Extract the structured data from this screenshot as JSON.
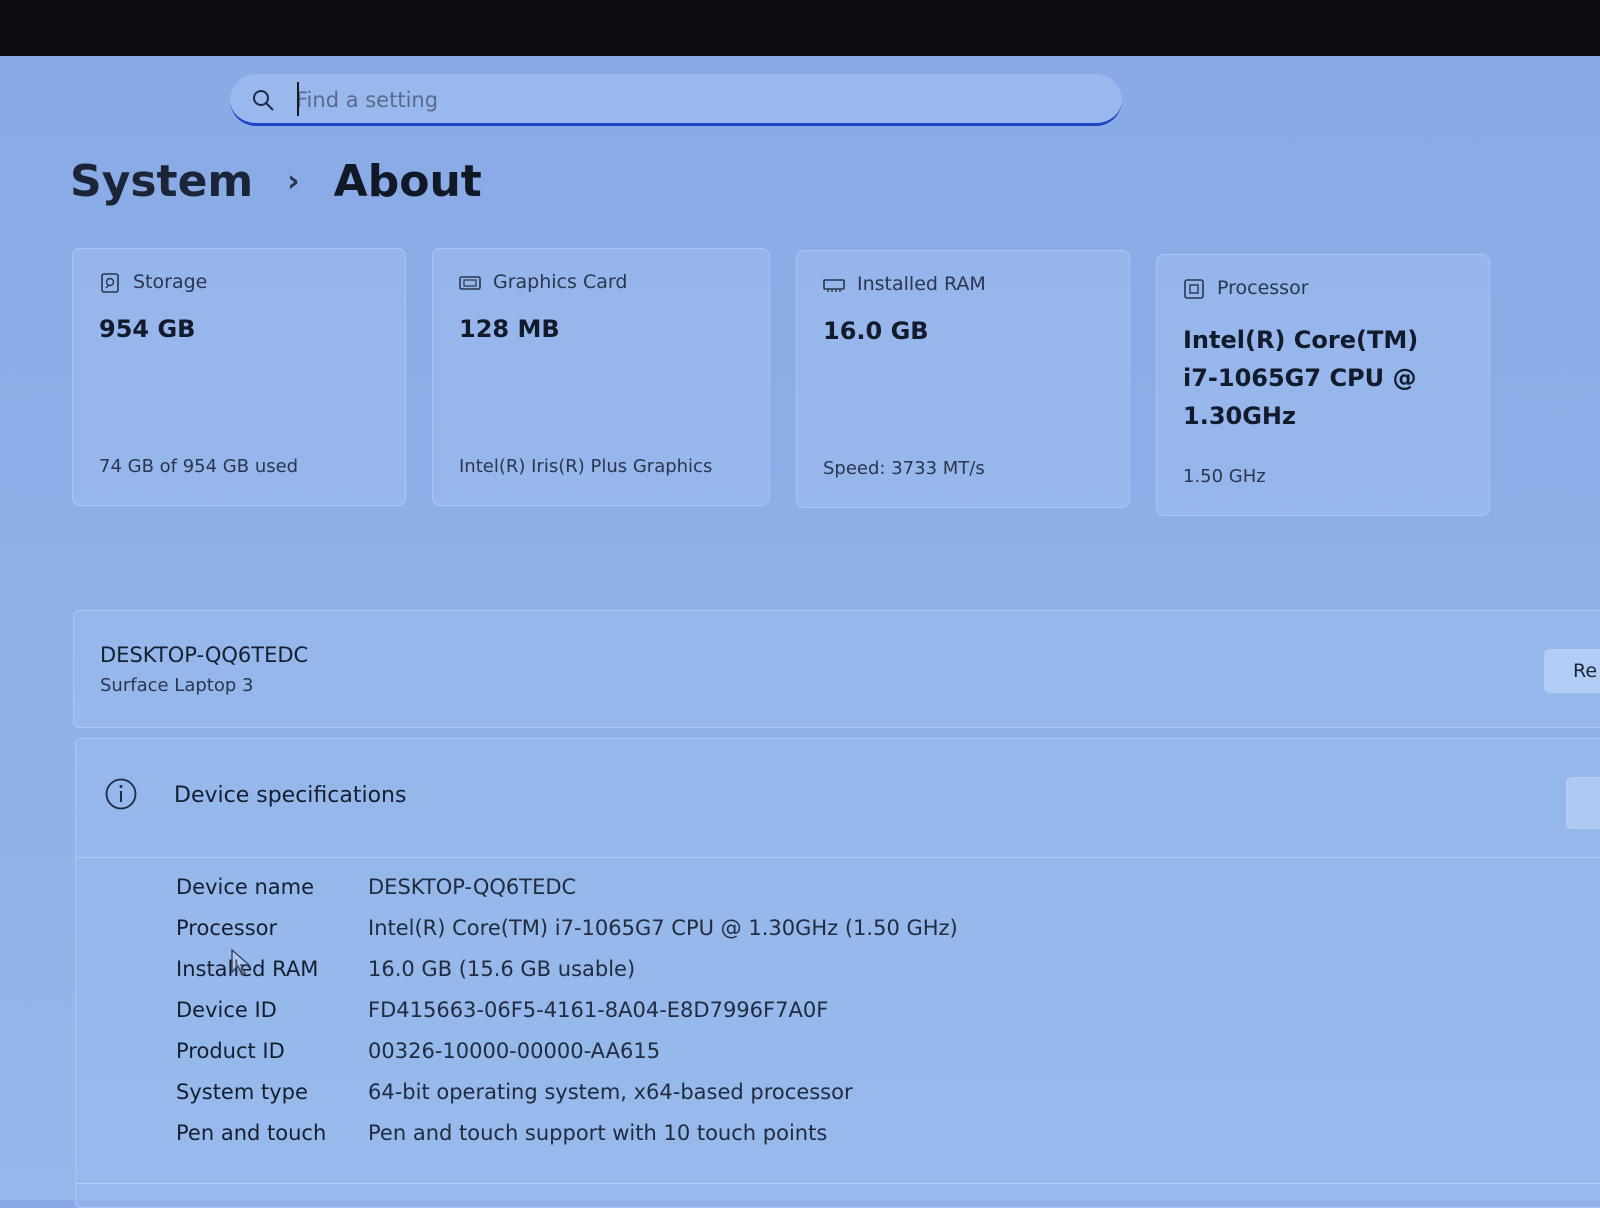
{
  "search": {
    "placeholder": "Find a setting",
    "value": ""
  },
  "breadcrumb": {
    "parent": "System",
    "current": "About"
  },
  "cards": [
    {
      "icon": "storage-icon",
      "label": "Storage",
      "value": "954 GB",
      "sub": "74 GB of 954 GB used"
    },
    {
      "icon": "graphics-card-icon",
      "label": "Graphics Card",
      "value": "128 MB",
      "sub": "Intel(R) Iris(R) Plus Graphics"
    },
    {
      "icon": "ram-icon",
      "label": "Installed RAM",
      "value": "16.0 GB",
      "sub": "Speed: 3733 MT/s"
    },
    {
      "icon": "processor-icon",
      "label": "Processor",
      "value": "Intel(R) Core(TM) i7-1065G7 CPU @ 1.30GHz",
      "sub": "1.50 GHz"
    }
  ],
  "device": {
    "name": "DESKTOP-QQ6TEDC",
    "model": "Surface Laptop 3",
    "rename_label": "Re"
  },
  "specs": {
    "title": "Device specifications",
    "rows": [
      {
        "key": "Device name",
        "value": "DESKTOP-QQ6TEDC"
      },
      {
        "key": "Processor",
        "value": "Intel(R) Core(TM) i7-1065G7 CPU @ 1.30GHz (1.50 GHz)"
      },
      {
        "key": "Installed RAM",
        "value": "16.0 GB (15.6 GB usable)"
      },
      {
        "key": "Device ID",
        "value": "FD415663-06F5-4161-8A04-E8D7996F7A0F"
      },
      {
        "key": "Product ID",
        "value": "00326-10000-00000-AA615"
      },
      {
        "key": "System type",
        "value": "64-bit operating system, x64-based processor"
      },
      {
        "key": "Pen and touch",
        "value": "Pen and touch support with 10 touch points"
      }
    ]
  }
}
